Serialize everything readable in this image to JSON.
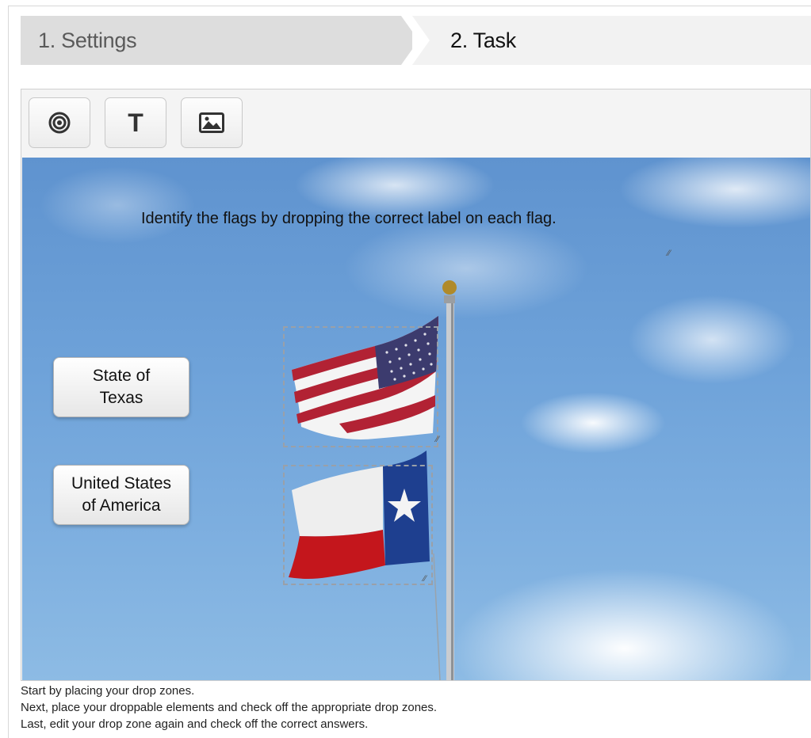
{
  "wizard": {
    "steps": [
      {
        "label": "1. Settings"
      },
      {
        "label": "2. Task"
      }
    ]
  },
  "toolbar": {
    "buttons": [
      {
        "icon": "target-icon"
      },
      {
        "icon": "text-icon",
        "glyph": "T"
      },
      {
        "icon": "image-icon"
      }
    ]
  },
  "canvas": {
    "question": "Identify the flags by dropping the correct label on each flag.",
    "labels": [
      {
        "text": "State of\nTexas"
      },
      {
        "text": "United States\nof America"
      }
    ]
  },
  "instructions": [
    "Start by placing your drop zones.",
    "Next, place your droppable elements and check off the appropriate drop zones.",
    "Last, edit your drop zone again and check off the correct answers."
  ],
  "colors": {
    "step_active": "#dddddd",
    "step_inactive": "#f2f2f2",
    "sky": "#6ea2d9"
  }
}
